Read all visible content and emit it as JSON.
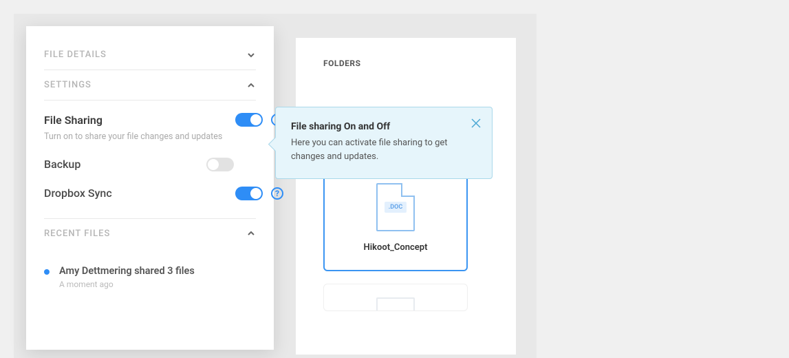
{
  "sidebar": {
    "sections": {
      "file_details": {
        "title": "FILE DETAILS",
        "expanded": false
      },
      "settings": {
        "title": "SETTINGS",
        "expanded": true,
        "items": {
          "file_sharing": {
            "label": "File Sharing",
            "description": "Turn on to share your file changes and updates",
            "on": true
          },
          "backup": {
            "label": "Backup",
            "on": false
          },
          "dropbox_sync": {
            "label": "Dropbox Sync",
            "on": true
          }
        }
      },
      "recent_files": {
        "title": "RECENT FILES",
        "expanded": true,
        "items": [
          {
            "text": "Amy Dettmering shared 3 files",
            "time": "A moment ago"
          }
        ]
      }
    }
  },
  "content": {
    "folders_label": "FOLDERS",
    "folder": {
      "name": "Hikoot_Concept",
      "ext_badge": ".DOC"
    }
  },
  "tooltip": {
    "title": "File sharing On and Off",
    "body": "Here you can activate file sharing to get changes and updates."
  }
}
